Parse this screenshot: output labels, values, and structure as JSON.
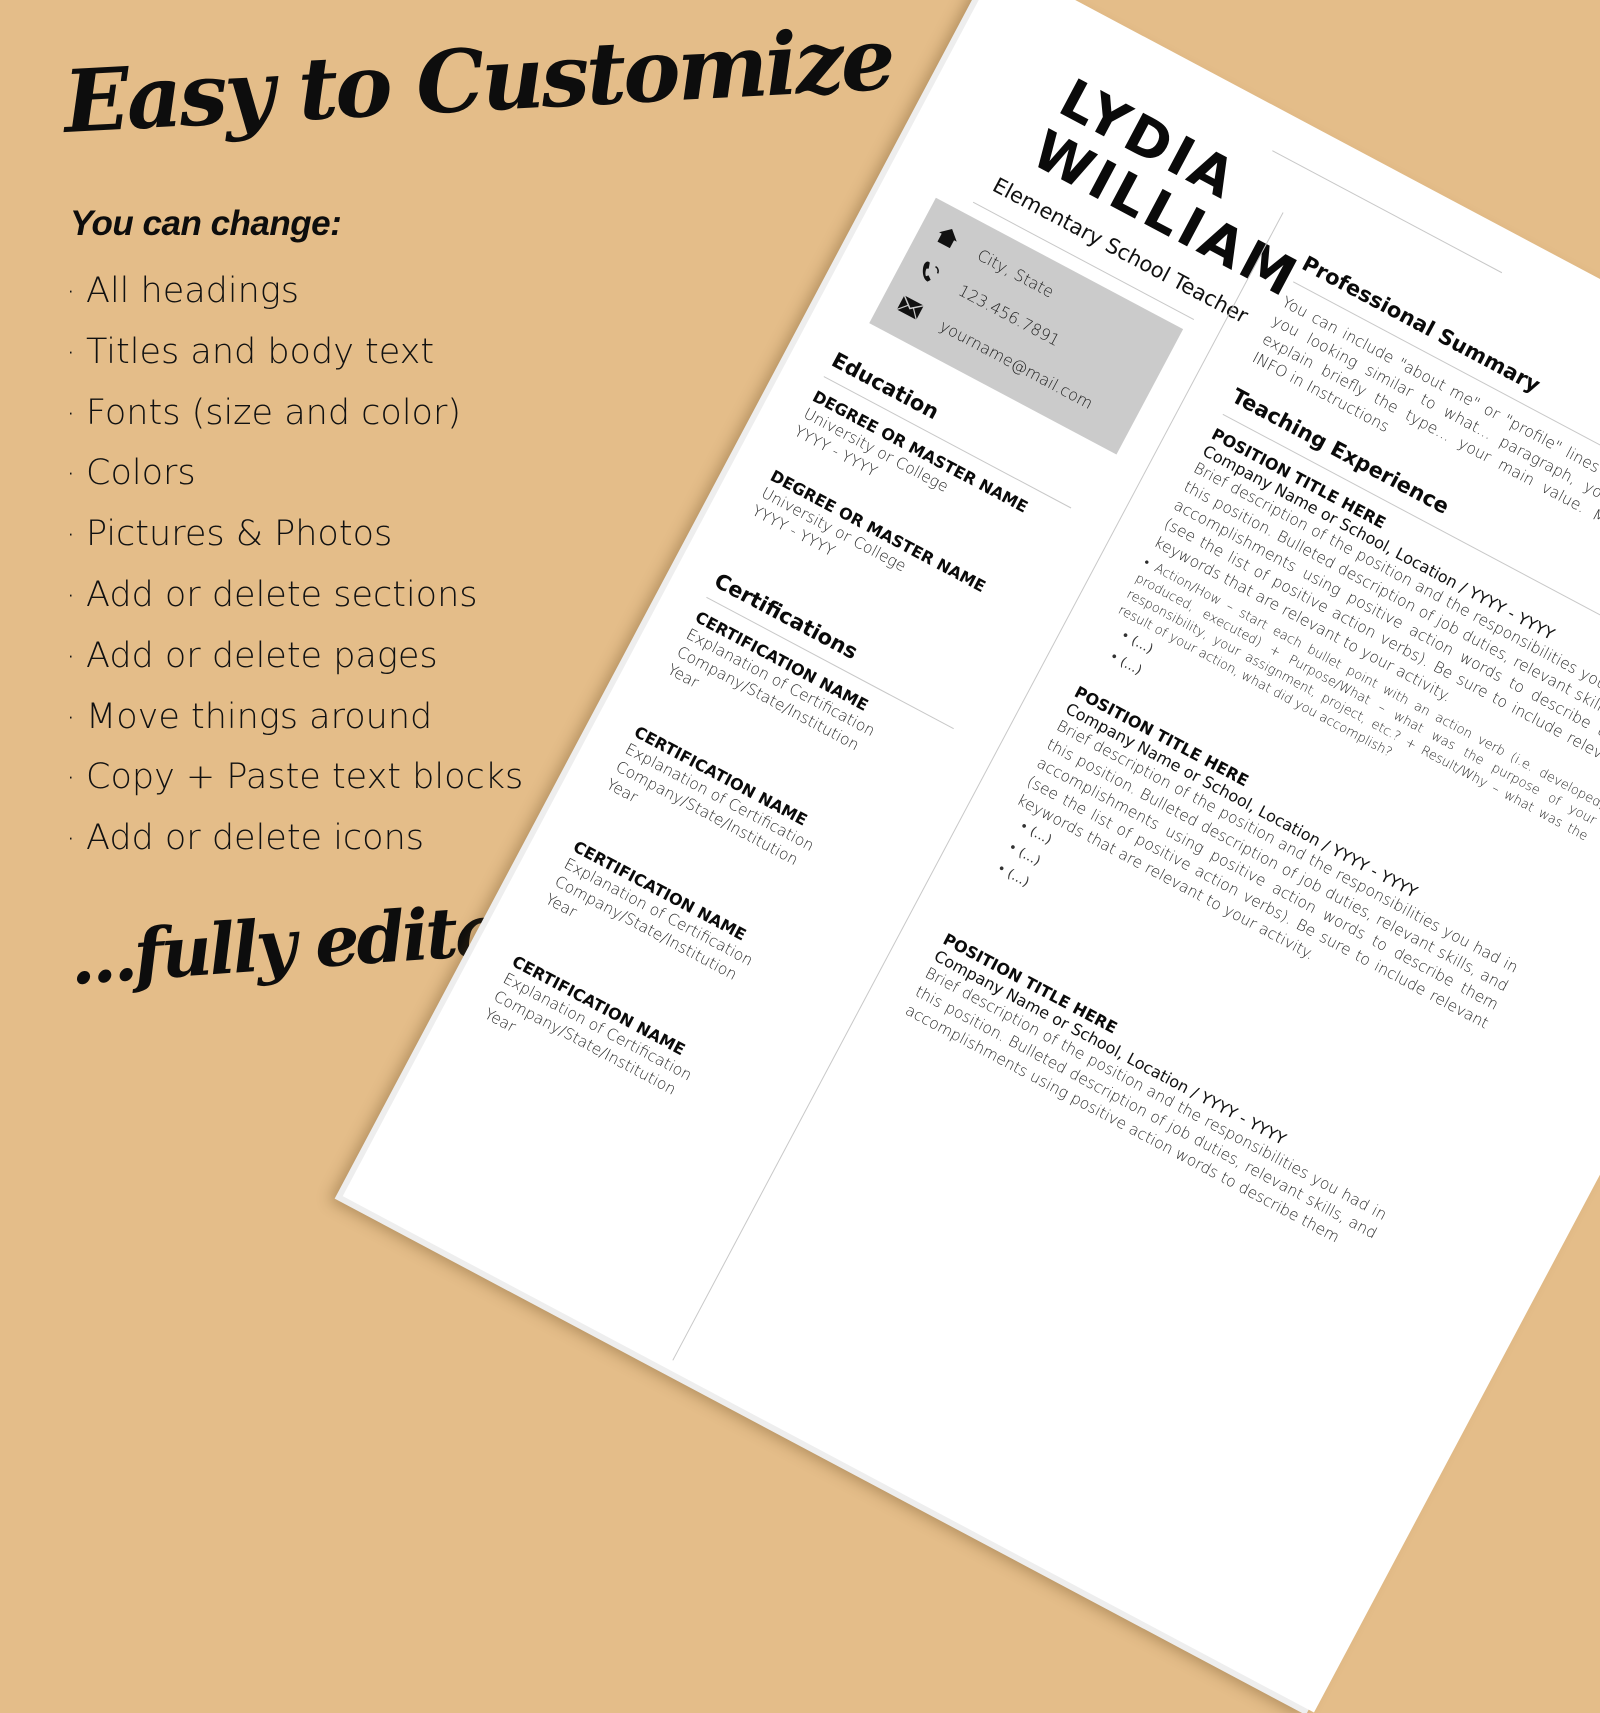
{
  "promo": {
    "headline": "Easy to Customize",
    "subhead": "You can change:",
    "bullet_glyph": "·",
    "features": [
      "All headings",
      "Titles and body text",
      "Fonts (size and color)",
      "Colors",
      "Pictures & Photos",
      "Add or delete sections",
      "Add or delete pages",
      "Move things around",
      "Copy + Paste text blocks",
      "Add or delete icons"
    ],
    "tagline": "...fully editable!"
  },
  "colors": {
    "background": "#e4bd89",
    "page": "#ffffff",
    "contact_box": "#cbcbcb",
    "text": "#141414"
  },
  "resume": {
    "name_line1": "LYDIA",
    "name_line2": "WILLIAM",
    "role": "Elementary School Teacher",
    "contact": {
      "location": {
        "icon": "home-icon",
        "text": "City, State"
      },
      "phone": {
        "icon": "phone-icon",
        "text": "123.456.7891"
      },
      "email": {
        "icon": "envelope-icon",
        "text": "yourname@mail.com"
      }
    },
    "education": {
      "title": "Education",
      "items": [
        {
          "degree": "DEGREE OR MASTER NAME",
          "school": "University or College",
          "years": "YYYY - YYYY"
        },
        {
          "degree": "DEGREE OR MASTER NAME",
          "school": "University or College",
          "years": "YYYY - YYYY"
        }
      ]
    },
    "certifications": {
      "title": "Certifications",
      "items": [
        {
          "name": "CERTIFICATION NAME",
          "explanation": "Explanation of Certification",
          "issuer": "Company/State/Institution",
          "year": "Year"
        },
        {
          "name": "CERTIFICATION NAME",
          "explanation": "Explanation of Certification",
          "issuer": "Company/State/Institution",
          "year": "Year"
        },
        {
          "name": "CERTIFICATION NAME",
          "explanation": "Explanation of Certification",
          "issuer": "Company/State/Institution",
          "year": "Year"
        },
        {
          "name": "CERTIFICATION NAME",
          "explanation": "Explanation of Certification",
          "issuer": "Company/State/Institution",
          "year": "Year"
        }
      ]
    },
    "summary": {
      "title": "Professional Summary",
      "text": "You can include \"about me\" or \"profile\" lines leaving you looking similar to what... paragraph, you can explain briefly the type... your main value. MORE INFO in Instructions"
    },
    "experience": {
      "title": "Teaching Experience",
      "items": [
        {
          "position": "POSITION TITLE HERE",
          "company": "Company Name or School, Location / YYYY - YYYY",
          "description": "Brief description of the position and the responsibilities you had in this position. Bulleted description of job duties, relevant skills, and accomplishments using positive action words to describe them (see the list of positive action verbs). Be sure to include relevant keywords that are relevant to your activity.",
          "detail": "• Action/How – start each bullet point with an action verb (i.e. developed, produced, executed) + Purpose/What – what was the purpose of your responsibility, your assignment, project, etc.? + Result/Why – what was the result of your action, what did you accomplish?",
          "bullets": [
            "(...)",
            "(...)"
          ]
        },
        {
          "position": "POSITION TITLE HERE",
          "company": "Company Name or School, Location / YYYY - YYYY",
          "description": "Brief description of the position and the responsibilities you had in this position. Bulleted description of job duties, relevant skills, and accomplishments using positive action words to describe them (see the list of positive action verbs). Be sure to include relevant keywords that are relevant to your activity.",
          "bullets": [
            "(...)",
            "(...)",
            "(...)"
          ]
        },
        {
          "position": "POSITION TITLE HERE",
          "company": "Company Name or School, Location / YYYY - YYYY",
          "description": "Brief description of the position and the responsibilities you had in this position. Bulleted description of job duties, relevant skills, and accomplishments using positive action words to describe them"
        }
      ]
    }
  }
}
